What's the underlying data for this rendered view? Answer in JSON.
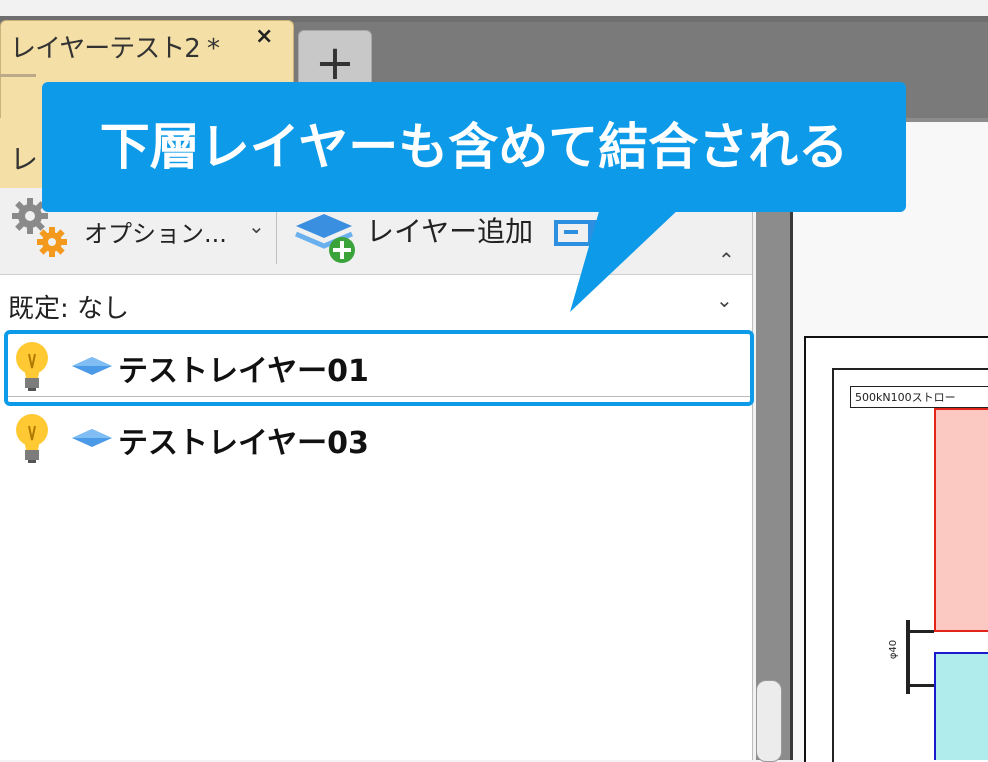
{
  "document_tab": {
    "title": "レイヤーテスト2 *",
    "close_glyph": "×",
    "new_tab_glyph": "+"
  },
  "panel": {
    "tab_label": "レ",
    "toolbar": {
      "options_label": "オプション...",
      "options_chevron": "⌄",
      "add_layer_label": "レイヤー追加",
      "scroll_up_glyph": "⌃"
    },
    "default_row": {
      "label": "既定: なし",
      "chevron": "⌄"
    },
    "layers": [
      {
        "name": "テストレイヤー01",
        "selected": true
      },
      {
        "name": "テストレイヤー03",
        "selected": false
      }
    ]
  },
  "callout": {
    "text": "下層レイヤーも含めて結合される",
    "color": "#0d9ae8"
  },
  "canvas": {
    "drawing_title": "500kN100ストロー",
    "dim_label": "φ40"
  },
  "colors": {
    "tab_active": "#f4dfa6",
    "highlight": "#0d9ae8",
    "red_fill": "#fbc8c2",
    "red_stroke": "#e3241b",
    "blue_fill": "#b0ecec",
    "blue_stroke": "#1a1acc"
  },
  "icons": {
    "options": "gear-icon",
    "add_layer": "layer-add-icon",
    "merge": "merge-icon",
    "visibility": "lightbulb-icon",
    "layer_type": "diamond-icon"
  }
}
